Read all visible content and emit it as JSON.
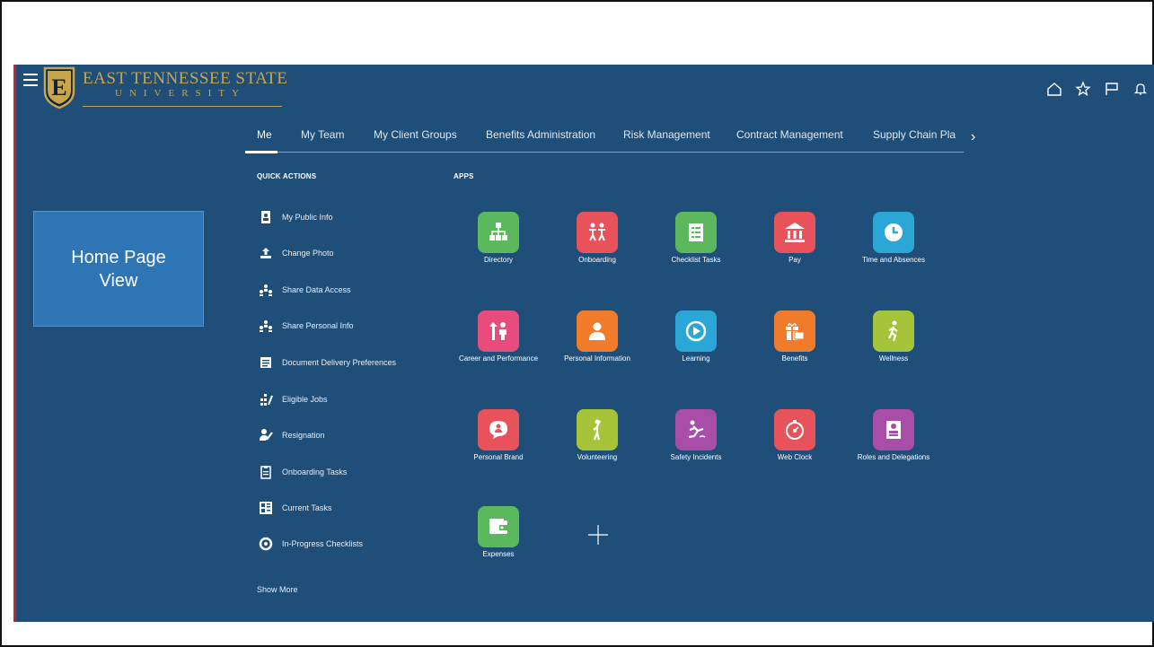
{
  "header": {
    "logo_line1": "EAST TENNESSEE STATE",
    "logo_line2": "UNIVERSITY",
    "logo_letter": "E"
  },
  "nav": {
    "tabs": [
      {
        "label": "Me"
      },
      {
        "label": "My Team"
      },
      {
        "label": "My Client Groups"
      },
      {
        "label": "Benefits Administration"
      },
      {
        "label": "Risk Management"
      },
      {
        "label": "Contract Management"
      },
      {
        "label": "Supply Chain Pla"
      }
    ],
    "active_tab": "Me"
  },
  "callout": {
    "text": "Home Page View"
  },
  "quick_actions": {
    "title": "QUICK ACTIONS",
    "items": [
      {
        "label": "My Public Info",
        "icon": "id-card-icon"
      },
      {
        "label": "Change Photo",
        "icon": "upload-icon"
      },
      {
        "label": "Share Data Access",
        "icon": "people-share-icon"
      },
      {
        "label": "Share Personal Info",
        "icon": "people-share-icon"
      },
      {
        "label": "Document Delivery Preferences",
        "icon": "document-icon"
      },
      {
        "label": "Eligible Jobs",
        "icon": "jobs-icon"
      },
      {
        "label": "Resignation",
        "icon": "person-check-icon"
      },
      {
        "label": "Onboarding Tasks",
        "icon": "clipboard-icon"
      },
      {
        "label": "Current Tasks",
        "icon": "tasks-grid-icon"
      },
      {
        "label": "In-Progress Checklists",
        "icon": "progress-icon"
      }
    ],
    "show_more": "Show More"
  },
  "apps": {
    "title": "APPS",
    "items": [
      {
        "label": "Directory",
        "color": "#5cb85c",
        "icon": "org-chart-icon"
      },
      {
        "label": "Onboarding",
        "color": "#e8525a",
        "icon": "people-walking-icon"
      },
      {
        "label": "Checklist Tasks",
        "color": "#5cb85c",
        "icon": "checklist-icon"
      },
      {
        "label": "Pay",
        "color": "#e8525a",
        "icon": "bank-icon"
      },
      {
        "label": "Time and Absences",
        "color": "#2aa7d6",
        "icon": "clock-icon"
      },
      {
        "label": "Career and Performance",
        "color": "#e84c7d",
        "icon": "career-icon"
      },
      {
        "label": "Personal Information",
        "color": "#f07b2a",
        "icon": "person-card-icon"
      },
      {
        "label": "Learning",
        "color": "#2aa7d6",
        "icon": "play-icon"
      },
      {
        "label": "Benefits",
        "color": "#f07b2a",
        "icon": "gift-icon"
      },
      {
        "label": "Wellness",
        "color": "#a6c43a",
        "icon": "runner-icon"
      },
      {
        "label": "Personal Brand",
        "color": "#e8525a",
        "icon": "chat-person-icon"
      },
      {
        "label": "Volunteering",
        "color": "#a6c43a",
        "icon": "volunteer-icon"
      },
      {
        "label": "Safety Incidents",
        "color": "#a94ea8",
        "icon": "fall-icon"
      },
      {
        "label": "Web Clock",
        "color": "#e8525a",
        "icon": "stopwatch-icon"
      },
      {
        "label": "Roles and Delegations",
        "color": "#a94ea8",
        "icon": "badge-icon"
      },
      {
        "label": "Expenses",
        "color": "#5cb85c",
        "icon": "wallet-icon"
      }
    ]
  },
  "colors": {
    "background": "#1f4e79",
    "callout": "#2e75b6",
    "gold": "#c9a64a"
  }
}
